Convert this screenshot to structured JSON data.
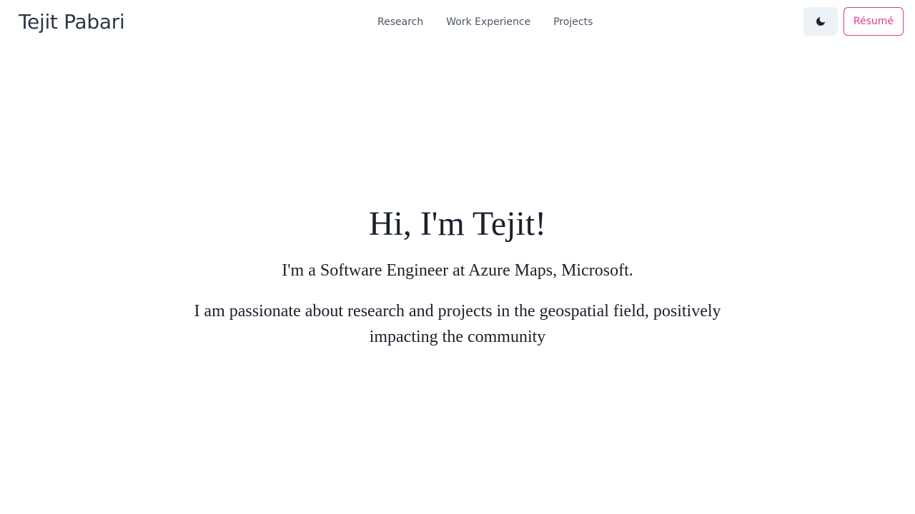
{
  "header": {
    "brand": "Tejit Pabari",
    "nav": [
      {
        "label": "Research"
      },
      {
        "label": "Work Experience"
      },
      {
        "label": "Projects"
      }
    ],
    "theme_toggle_icon": "moon-icon",
    "resume_label": "Résumé",
    "accent_color": "#d53f8c"
  },
  "hero": {
    "title": "Hi, I'm Tejit!",
    "subtitle": "I'm a Software Engineer at Azure Maps, Microsoft.",
    "description": "I am passionate about research and projects in the geospatial field, positively impacting the community"
  }
}
